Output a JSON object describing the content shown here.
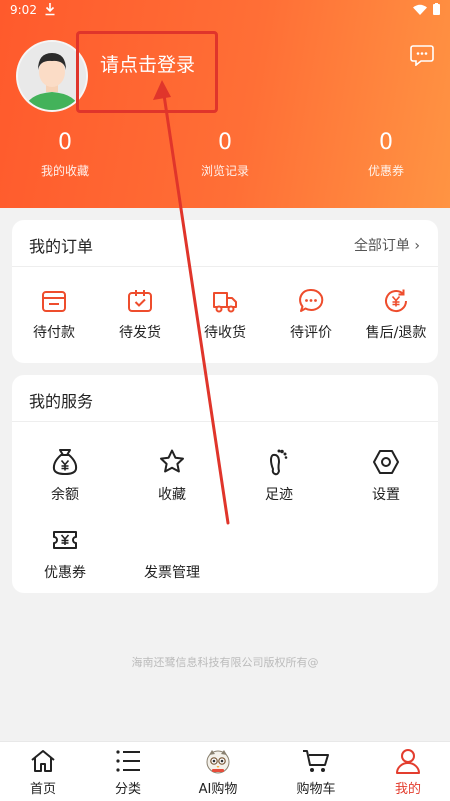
{
  "status_bar": {
    "time": "9:02"
  },
  "header": {
    "login_text": "请点击登录",
    "stats": [
      {
        "value": "0",
        "label": "我的收藏"
      },
      {
        "value": "0",
        "label": "浏览记录"
      },
      {
        "value": "0",
        "label": "优惠券"
      }
    ]
  },
  "orders": {
    "title": "我的订单",
    "all_link": "全部订单 ›",
    "items": [
      {
        "label": "待付款",
        "icon": "wallet-icon"
      },
      {
        "label": "待发货",
        "icon": "package-icon"
      },
      {
        "label": "待收货",
        "icon": "truck-icon"
      },
      {
        "label": "待评价",
        "icon": "comment-icon"
      },
      {
        "label": "售后/退款",
        "icon": "refund-icon"
      }
    ]
  },
  "services": {
    "title": "我的服务",
    "items": [
      {
        "label": "余额",
        "icon": "money-bag-icon"
      },
      {
        "label": "收藏",
        "icon": "star-icon"
      },
      {
        "label": "足迹",
        "icon": "footprint-icon"
      },
      {
        "label": "设置",
        "icon": "settings-icon"
      },
      {
        "label": "优惠券",
        "icon": "coupon-icon"
      },
      {
        "label": "发票管理",
        "icon": ""
      }
    ]
  },
  "footer": {
    "copyright": "海南还鹭信息科技有限公司版权所有@"
  },
  "tabbar": {
    "tabs": [
      {
        "label": "首页",
        "icon": "home-icon"
      },
      {
        "label": "分类",
        "icon": "category-icon"
      },
      {
        "label": "AI购物",
        "icon": "ai-mascot-icon"
      },
      {
        "label": "购物车",
        "icon": "cart-icon"
      },
      {
        "label": "我的",
        "icon": "user-icon"
      }
    ],
    "active": "我的"
  },
  "colors": {
    "accent": "#e33d2e",
    "header_start": "#ff5a2c",
    "header_end": "#ff9443",
    "annotation": "#e0352b"
  }
}
